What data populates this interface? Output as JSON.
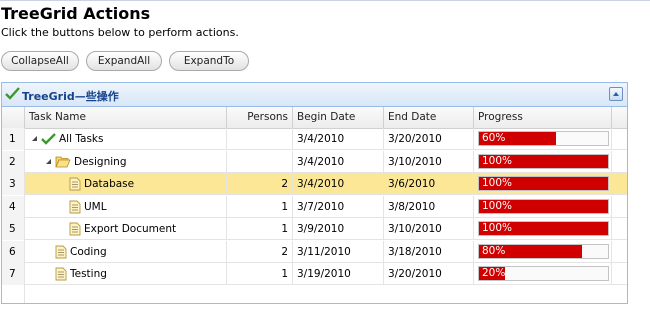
{
  "page": {
    "title": "TreeGrid Actions",
    "subtitle": "Click the buttons below to perform actions."
  },
  "buttons": {
    "collapse_all": "CollapseAll",
    "expand_all": "ExpandAll",
    "expand_to": "ExpandTo"
  },
  "panel": {
    "title": "TreeGrid—些操作"
  },
  "columns": {
    "task_name": "Task Name",
    "persons": "Persons",
    "begin_date": "Begin Date",
    "end_date": "End Date",
    "progress": "Progress"
  },
  "rows": [
    {
      "index": "1",
      "name": "All Tasks",
      "icon": "check-icon",
      "persons": "",
      "begin": "3/4/2010",
      "end": "3/20/2010",
      "progress": 60,
      "progress_label": "60%",
      "level": 0,
      "expander": true
    },
    {
      "index": "2",
      "name": "Designing",
      "icon": "folder-open-icon",
      "persons": "",
      "begin": "3/4/2010",
      "end": "3/10/2010",
      "progress": 100,
      "progress_label": "100%",
      "level": 1,
      "expander": true
    },
    {
      "index": "3",
      "name": "Database",
      "icon": "file-icon",
      "persons": "2",
      "begin": "3/4/2010",
      "end": "3/6/2010",
      "progress": 100,
      "progress_label": "100%",
      "level": 2,
      "expander": false,
      "selected": true
    },
    {
      "index": "4",
      "name": "UML",
      "icon": "file-icon",
      "persons": "1",
      "begin": "3/7/2010",
      "end": "3/8/2010",
      "progress": 100,
      "progress_label": "100%",
      "level": 2,
      "expander": false
    },
    {
      "index": "5",
      "name": "Export Document",
      "icon": "file-icon",
      "persons": "1",
      "begin": "3/9/2010",
      "end": "3/10/2010",
      "progress": 100,
      "progress_label": "100%",
      "level": 2,
      "expander": false
    },
    {
      "index": "6",
      "name": "Coding",
      "icon": "file-icon",
      "persons": "2",
      "begin": "3/11/2010",
      "end": "3/18/2010",
      "progress": 80,
      "progress_label": "80%",
      "level": 1,
      "expander": false
    },
    {
      "index": "7",
      "name": "Testing",
      "icon": "file-icon",
      "persons": "1",
      "begin": "3/19/2010",
      "end": "3/20/2010",
      "progress": 20,
      "progress_label": "20%",
      "level": 1,
      "expander": false
    }
  ],
  "colors": {
    "progress_fill": "#d10000",
    "selected_row": "#fbe795",
    "header_text": "#15428b"
  }
}
